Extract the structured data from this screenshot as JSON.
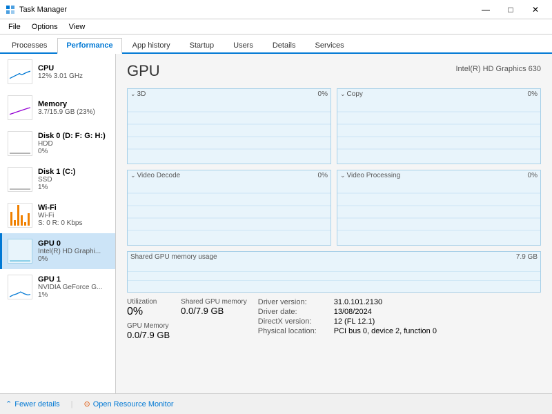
{
  "window": {
    "title": "Task Manager",
    "controls": {
      "minimize": "—",
      "maximize": "□",
      "close": "✕"
    }
  },
  "menubar": {
    "items": [
      "File",
      "Options",
      "View"
    ]
  },
  "tabs": {
    "items": [
      "Processes",
      "Performance",
      "App history",
      "Startup",
      "Users",
      "Details",
      "Services"
    ],
    "active": "Performance"
  },
  "sidebar": {
    "items": [
      {
        "id": "cpu",
        "name": "CPU",
        "detail1": "12% 3.01 GHz",
        "detail2": ""
      },
      {
        "id": "memory",
        "name": "Memory",
        "detail1": "3.7/15.9 GB (23%)",
        "detail2": ""
      },
      {
        "id": "disk0",
        "name": "Disk 0 (D: F: G: H:)",
        "detail1": "HDD",
        "detail2": "0%"
      },
      {
        "id": "disk1",
        "name": "Disk 1 (C:)",
        "detail1": "SSD",
        "detail2": "1%"
      },
      {
        "id": "wifi",
        "name": "Wi-Fi",
        "detail1": "Wi-Fi",
        "detail2": "S: 0 R: 0 Kbps"
      },
      {
        "id": "gpu0",
        "name": "GPU 0",
        "detail1": "Intel(R) HD Graphi...",
        "detail2": "0%",
        "active": true
      },
      {
        "id": "gpu1",
        "name": "GPU 1",
        "detail1": "NVIDIA GeForce G...",
        "detail2": "1%"
      }
    ]
  },
  "main": {
    "gpu_title": "GPU",
    "gpu_fullname": "Intel(R) HD Graphics 630",
    "charts": [
      {
        "label": "3D",
        "pct": "0%"
      },
      {
        "label": "Copy",
        "pct": "0%"
      },
      {
        "label": "Video Decode",
        "pct": "0%"
      },
      {
        "label": "Video Processing",
        "pct": "0%"
      }
    ],
    "shared_label": "Shared GPU memory usage",
    "shared_pct": "7.9 GB",
    "stats": {
      "utilization_label": "Utilization",
      "utilization_value": "0%",
      "shared_mem_label": "Shared GPU memory",
      "shared_mem_value": "0.0/7.9 GB",
      "gpu_mem_label": "GPU Memory",
      "gpu_mem_value": "0.0/7.9 GB"
    },
    "driver": {
      "version_label": "Driver version:",
      "version_value": "31.0.101.2130",
      "date_label": "Driver date:",
      "date_value": "13/08/2024",
      "directx_label": "DirectX version:",
      "directx_value": "12 (FL 12.1)",
      "location_label": "Physical location:",
      "location_value": "PCI bus 0, device 2, function 0"
    }
  },
  "footer": {
    "fewer_details": "Fewer details",
    "open_monitor": "Open Resource Monitor",
    "divider": "|"
  }
}
